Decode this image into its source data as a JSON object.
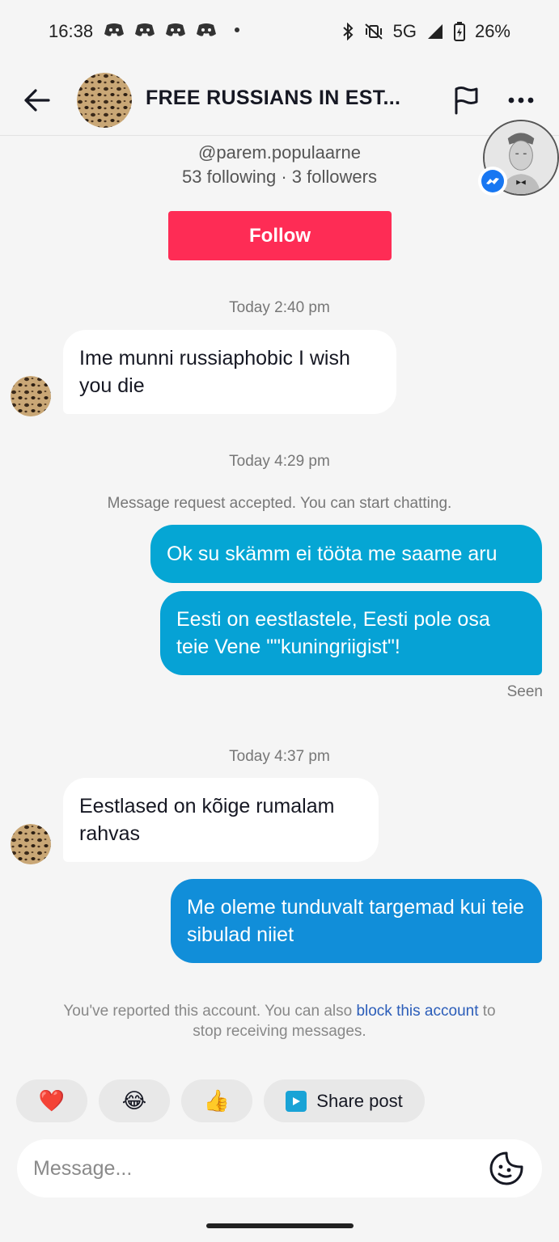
{
  "status_bar": {
    "time": "16:38",
    "network": "5G",
    "battery": "26%",
    "notification_icons": [
      "discord-icon",
      "discord-icon",
      "discord-icon",
      "discord-icon"
    ]
  },
  "header": {
    "title": "FREE RUSSIANS IN EST...",
    "back_icon": "arrow-left-icon",
    "report_icon": "flag-icon",
    "more_icon": "more-dots-icon"
  },
  "profile": {
    "handle": "@parem.populaarne",
    "stats": "53 following · 3 followers",
    "follow_label": "Follow"
  },
  "conversation": {
    "timestamp_1": "Today 2:40 pm",
    "msg_1": "Ime munni russiaphobic I wish you die",
    "timestamp_2": "Today 4:29 pm",
    "system_1": "Message request accepted. You can start chatting.",
    "msg_2": "Ok su skämm ei tööta me saame aru",
    "msg_3": "Eesti on eestlastele, Eesti pole osa teie Vene \"\"kuningriigist\"!",
    "seen": "Seen",
    "timestamp_3": "Today 4:37 pm",
    "msg_4": "Eestlased on kõige rumalam rahvas",
    "msg_5": "Me oleme tunduvalt targemad kui teie sibulad niiet"
  },
  "report_note": {
    "prefix": "You've reported this account. You can also ",
    "link": "block this account",
    "suffix": " to stop receiving messages."
  },
  "quick_actions": {
    "heart": "❤️",
    "laugh": "😂",
    "thumbs": "👍",
    "share_label": "Share post"
  },
  "composer": {
    "placeholder": "Message..."
  },
  "colors": {
    "follow": "#fe2c55",
    "bubble_out": "#05a6d4",
    "bubble_out_last": "#118ed9",
    "link": "#2b5db9"
  }
}
